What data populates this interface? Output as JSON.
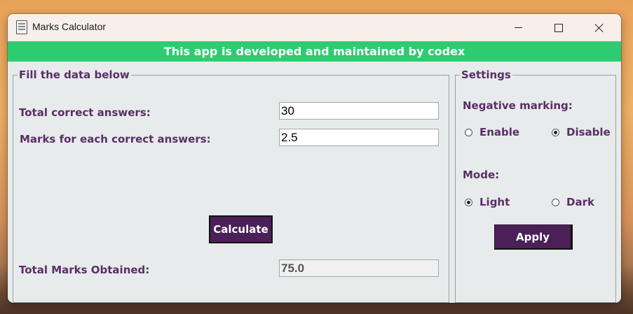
{
  "window": {
    "title": "Marks Calculator"
  },
  "banner": {
    "text": "This app is developed and maintained by codex",
    "color": "#2ecc71"
  },
  "data_frame": {
    "title": "Fill the data below",
    "correct_label": "Total correct answers:",
    "correct_value": "30",
    "marks_label": "Marks for each correct answers:",
    "marks_value": "2.5",
    "calculate_label": "Calculate",
    "result_label": "Total Marks Obtained:",
    "result_value": "75.0"
  },
  "settings": {
    "title": "Settings",
    "negative_label": "Negative marking:",
    "enable_label": "Enable",
    "disable_label": "Disable",
    "negative_selected": "Disable",
    "mode_label": "Mode:",
    "light_label": "Light",
    "dark_label": "Dark",
    "mode_selected": "Light",
    "apply_label": "Apply"
  },
  "colors": {
    "accent": "#4b1f57",
    "label_text": "#5a2e67",
    "banner": "#2ecc71"
  },
  "icons": {
    "app": "document-icon",
    "minimize": "minimize-icon",
    "maximize": "maximize-icon",
    "close": "close-icon"
  }
}
